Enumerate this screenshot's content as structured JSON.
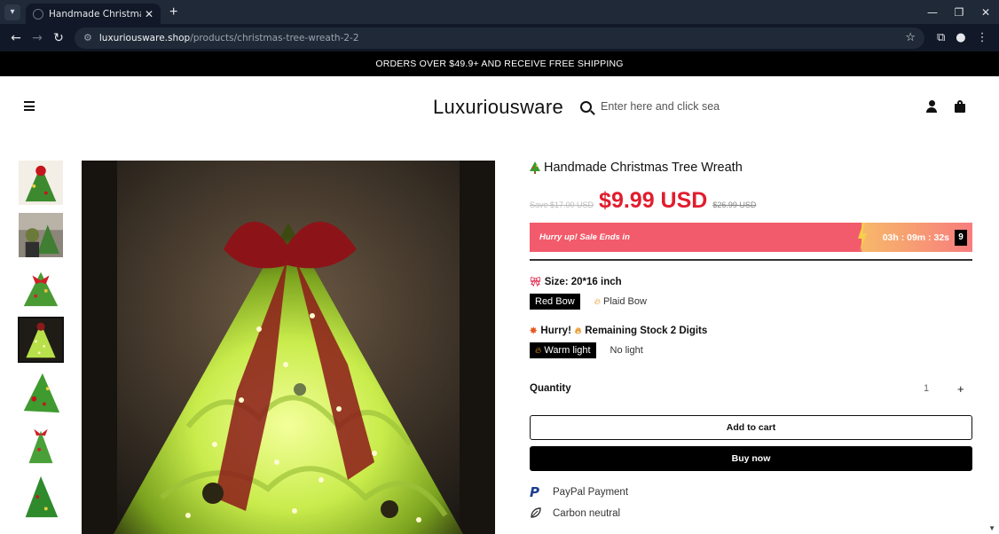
{
  "browser": {
    "tab_title": "Handmade Christmas Tree W",
    "url_host": "luxuriousware.shop",
    "url_path": "/products/christmas-tree-wreath-2-2"
  },
  "announcement": "ORDERS OVER $49.9+ AND RECEIVE FREE SHIPPING",
  "header": {
    "logo": "Luxuriousware",
    "search_placeholder": "Enter here and click sea"
  },
  "product": {
    "title": "Handmade Christmas Tree Wreath",
    "save_text": "Save $17.00 USD",
    "price": "$9.99 USD",
    "compare_price": "$26.99 USD",
    "sale_text": "Hurry up! Sale Ends in",
    "countdown": "03h : 09m : 32s",
    "countdown_seconds_box": "9",
    "size_label": "Size: 20*16 inch",
    "size_options": [
      "Red Bow",
      "Plaid Bow"
    ],
    "selected_size": "Red Bow",
    "stock_label_a": "Hurry!",
    "stock_label_b": "Remaining Stock 2 Digits",
    "light_options": [
      "Warm light",
      "No light"
    ],
    "selected_light": "Warm light",
    "quantity_label": "Quantity",
    "quantity": "1",
    "add_to_cart": "Add to cart",
    "buy_now": "Buy now",
    "features": [
      "PayPal Payment",
      "Carbon neutral"
    ]
  },
  "colors": {
    "price_red": "#e11d2e",
    "sale_bar": "#f25b6b",
    "announcement_bg": "#000000"
  }
}
